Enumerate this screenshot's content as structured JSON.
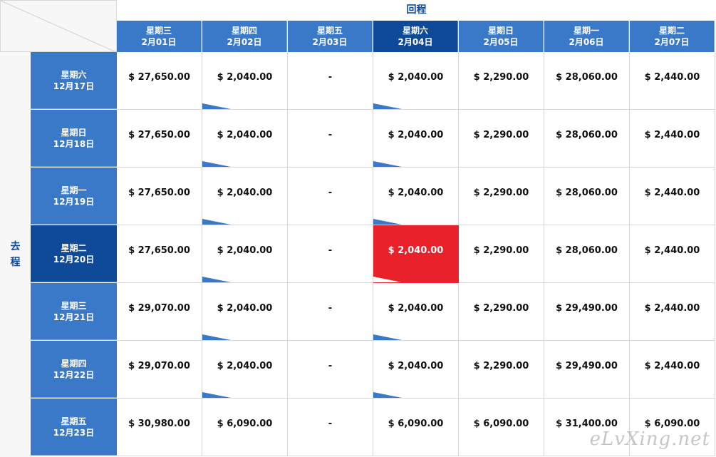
{
  "labels": {
    "return": "回程",
    "depart": "去程"
  },
  "columns": [
    {
      "weekday": "星期三",
      "date": "2月01日"
    },
    {
      "weekday": "星期四",
      "date": "2月02日"
    },
    {
      "weekday": "星期五",
      "date": "2月03日"
    },
    {
      "weekday": "星期六",
      "date": "2月04日"
    },
    {
      "weekday": "星期日",
      "date": "2月05日"
    },
    {
      "weekday": "星期一",
      "date": "2月06日"
    },
    {
      "weekday": "星期二",
      "date": "2月07日"
    }
  ],
  "rows": [
    {
      "weekday": "星期六",
      "date": "12月17日",
      "prices": [
        "$ 27,650.00",
        "$ 2,040.00",
        "-",
        "$ 2,040.00",
        "$ 2,290.00",
        "$ 28,060.00",
        "$ 2,440.00"
      ]
    },
    {
      "weekday": "星期日",
      "date": "12月18日",
      "prices": [
        "$ 27,650.00",
        "$ 2,040.00",
        "-",
        "$ 2,040.00",
        "$ 2,290.00",
        "$ 28,060.00",
        "$ 2,440.00"
      ]
    },
    {
      "weekday": "星期一",
      "date": "12月19日",
      "prices": [
        "$ 27,650.00",
        "$ 2,040.00",
        "-",
        "$ 2,040.00",
        "$ 2,290.00",
        "$ 28,060.00",
        "$ 2,440.00"
      ]
    },
    {
      "weekday": "星期二",
      "date": "12月20日",
      "prices": [
        "$ 27,650.00",
        "$ 2,040.00",
        "-",
        "$ 2,040.00",
        "$ 2,290.00",
        "$ 28,060.00",
        "$ 2,440.00"
      ]
    },
    {
      "weekday": "星期三",
      "date": "12月21日",
      "prices": [
        "$ 29,070.00",
        "$ 2,040.00",
        "-",
        "$ 2,040.00",
        "$ 2,290.00",
        "$ 29,490.00",
        "$ 2,440.00"
      ]
    },
    {
      "weekday": "星期四",
      "date": "12月22日",
      "prices": [
        "$ 29,070.00",
        "$ 2,040.00",
        "-",
        "$ 2,040.00",
        "$ 2,290.00",
        "$ 29,490.00",
        "$ 2,440.00"
      ]
    },
    {
      "weekday": "星期五",
      "date": "12月23日",
      "prices": [
        "$ 30,980.00",
        "$ 6,090.00",
        "-",
        "$ 6,090.00",
        "$ 6,090.00",
        "$ 31,400.00",
        "$ 6,090.00"
      ]
    }
  ],
  "selected": {
    "row": 3,
    "col": 3
  },
  "flagged_columns": [
    1,
    3
  ],
  "flagged_rows": [
    0,
    1,
    2,
    3,
    4,
    5
  ],
  "colors": {
    "header": "#3a78c8",
    "header_active": "#0f4a98",
    "selected": "#e8212b",
    "flag": "#3a78c8"
  },
  "watermark": "eLvXing.net"
}
